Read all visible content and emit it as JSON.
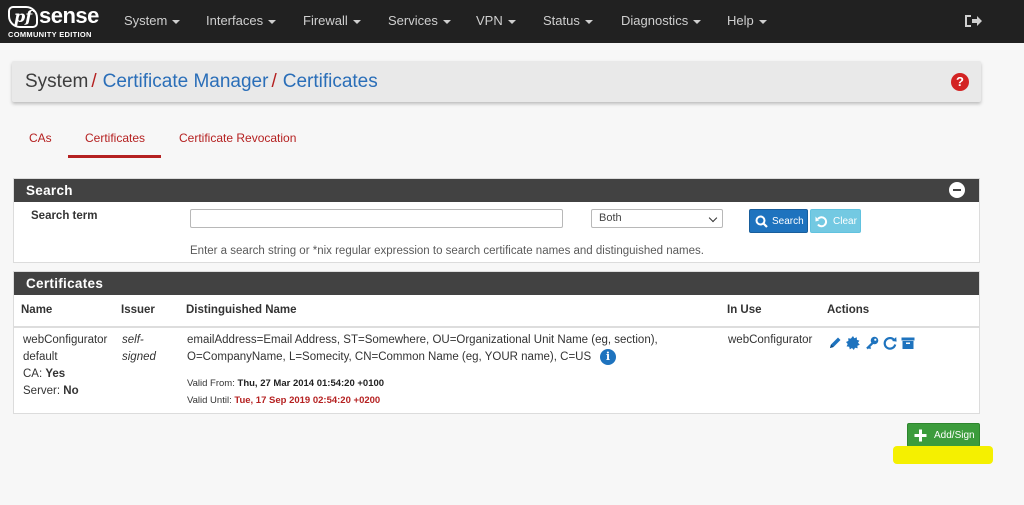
{
  "brand": {
    "name_pf": "pf",
    "name_sense": "sense",
    "edition": "COMMUNITY EDITION"
  },
  "nav": {
    "items": [
      "System",
      "Interfaces",
      "Firewall",
      "Services",
      "VPN",
      "Status",
      "Diagnostics",
      "Help"
    ],
    "logout_icon": "sign-out-icon"
  },
  "breadcrumb": {
    "root": "System",
    "section": "Certificate Manager",
    "page": "Certificates",
    "separator": "/"
  },
  "help_icon": "?",
  "tabs": [
    "CAs",
    "Certificates",
    "Certificate Revocation"
  ],
  "active_tab": "Certificates",
  "search": {
    "title": "Search",
    "label": "Search term",
    "input_value": "",
    "select_value": "Both",
    "search_button": "Search",
    "clear_button": "Clear",
    "help_text": "Enter a search string or *nix regular expression to search certificate names and distinguished names."
  },
  "certificates": {
    "title": "Certificates",
    "columns": [
      "Name",
      "Issuer",
      "Distinguished Name",
      "In Use",
      "Actions"
    ],
    "rows": [
      {
        "name_line1": "webConfigurator",
        "name_line2": "default",
        "ca_label": "CA:",
        "ca_value": "Yes",
        "server_label": "Server:",
        "server_value": "No",
        "issuer_line1": "self-",
        "issuer_line2": "signed",
        "dn_line1": "emailAddress=Email Address, ST=Somewhere, OU=Organizational Unit Name (eg, section),",
        "dn_line2": "O=CompanyName, L=Somecity, CN=Common Name (eg, YOUR name), C=US",
        "valid_from_label": "Valid From:",
        "valid_from": "Thu, 27 Mar 2014 01:54:20 +0100",
        "valid_until_label": "Valid Until:",
        "valid_until": "Tue, 17 Sep 2019 02:54:20 +0200",
        "in_use": "webConfigurator",
        "actions": [
          "edit-icon",
          "export-icon",
          "key-icon",
          "renew-icon",
          "delete-icon"
        ]
      }
    ]
  },
  "add_button": "Add/Sign",
  "colors": {
    "accent_red": "#b52121",
    "link_blue": "#2a6eb8",
    "navbar": "#212121",
    "panel_head": "#424242",
    "add_green": "#3c9c3c",
    "highlight": "#f5f000"
  }
}
